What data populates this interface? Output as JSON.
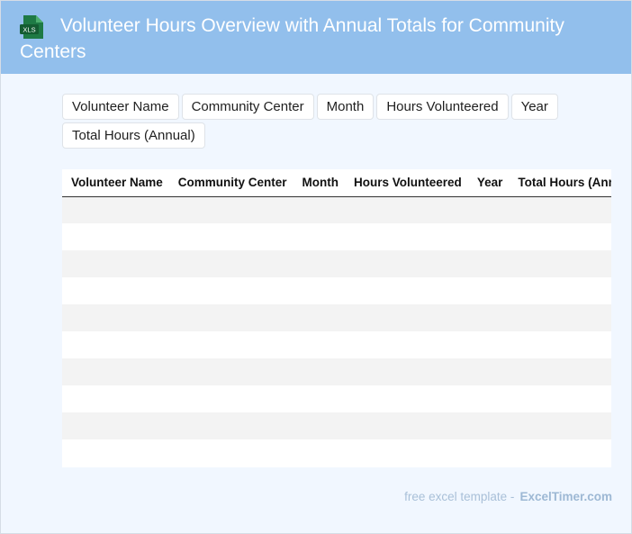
{
  "header": {
    "icon": "xls-file-icon",
    "icon_text": "XLS",
    "title": "Volunteer Hours Overview with Annual Totals for Community Centers"
  },
  "columns": [
    "Volunteer Name",
    "Community Center",
    "Month",
    "Hours Volunteered",
    "Year",
    "Total Hours (Annual)"
  ],
  "footer": {
    "text": "free excel template -",
    "brand": "ExcelTimer.com"
  },
  "colors": {
    "header_bg": "#92bfec",
    "page_bg": "#f1f7ff",
    "icon_green": "#1e7a45"
  }
}
